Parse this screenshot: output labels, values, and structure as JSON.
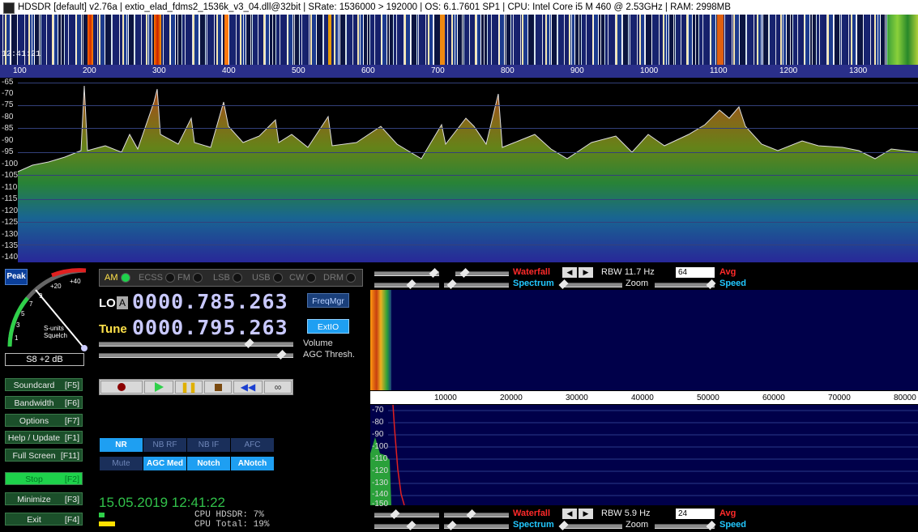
{
  "titlebar": {
    "text": "HDSDR  [default]  v2.76a  |  extio_elad_fdms2_1536k_v3_04.dll@32bit  |  SRate: 1536000 > 192000  |  OS: 6.1.7601 SP1  |  CPU: Intel Core i5       M 460  @ 2.53GHz  |  RAM: 2998MB"
  },
  "waterfall": {
    "time": "12:41:21"
  },
  "freq_axis": [
    "100",
    "200",
    "300",
    "400",
    "500",
    "600",
    "700",
    "800",
    "900",
    "1000",
    "1100",
    "1200",
    "1300"
  ],
  "spectrum_y": [
    "-65",
    "-70",
    "-75",
    "-80",
    "-85",
    "-90",
    "-95",
    "-100",
    "-105",
    "-110",
    "-115",
    "-120",
    "-125",
    "-130",
    "-135",
    "-140"
  ],
  "smeter": {
    "peak": "Peak",
    "reading": "S8 +2 dB",
    "scale_label": "S-units",
    "squelch_label": "Squelch",
    "ticks": [
      "1",
      "3",
      "5",
      "7",
      "9",
      "+20",
      "+40"
    ]
  },
  "left_buttons": [
    {
      "label": "Soundcard",
      "key": "[F5]"
    },
    {
      "label": "Bandwidth",
      "key": "[F6]"
    },
    {
      "label": "Options",
      "key": "[F7]"
    },
    {
      "label": "Help / Update",
      "key": "[F1]"
    },
    {
      "label": "Full Screen",
      "key": "[F11]"
    },
    {
      "label": "Stop",
      "key": "[F2]"
    },
    {
      "label": "Minimize",
      "key": "[F3]"
    },
    {
      "label": "Exit",
      "key": "[F4]"
    }
  ],
  "modes": [
    "AM",
    "ECSS",
    "FM",
    "LSB",
    "USB",
    "CW",
    "DRM"
  ],
  "active_mode": "AM",
  "lo": {
    "label": "LO",
    "vfo": "A",
    "freq": "0000.785.263"
  },
  "tune": {
    "label": "Tune",
    "freq": "0000.795.263"
  },
  "buttons": {
    "freqmgr": "FreqMgr",
    "extio": "ExtIO"
  },
  "sliders": {
    "volume": "Volume",
    "agc": "AGC Thresh."
  },
  "dsp": [
    {
      "label": "NR",
      "on": true
    },
    {
      "label": "NB RF",
      "on": false
    },
    {
      "label": "NB IF",
      "on": false
    },
    {
      "label": "AFC",
      "on": false
    },
    {
      "label": "Mute",
      "on": false
    },
    {
      "label": "AGC Med",
      "on": true
    },
    {
      "label": "Notch",
      "on": true
    },
    {
      "label": "ANotch",
      "on": true
    }
  ],
  "datetime": "15.05.2019 12:41:22",
  "cpu": {
    "hdsdr": "CPU HDSDR:  7%",
    "total": "CPU Total: 19%"
  },
  "top_controls": {
    "waterfall": "Waterfall",
    "spectrum": "Spectrum",
    "rbw": "RBW 11.7 Hz",
    "combo": "64",
    "avg": "Avg",
    "zoom": "Zoom",
    "speed": "Speed"
  },
  "bottom_controls": {
    "waterfall": "Waterfall",
    "spectrum": "Spectrum",
    "rbw": "RBW  5.9 Hz",
    "combo": "24",
    "avg": "Avg",
    "zoom": "Zoom",
    "speed": "Speed"
  },
  "audio_axis": [
    "10000",
    "20000",
    "30000",
    "40000",
    "50000",
    "60000",
    "70000",
    "80000"
  ],
  "audio_y": [
    "-70",
    "-80",
    "-90",
    "-100",
    "-110",
    "-120",
    "-130",
    "-140",
    "-150"
  ],
  "colors": {
    "accent": "#1e9ff2",
    "active": "#1ed24b",
    "red": "#ff2a2a",
    "cyan": "#22c8ff"
  }
}
